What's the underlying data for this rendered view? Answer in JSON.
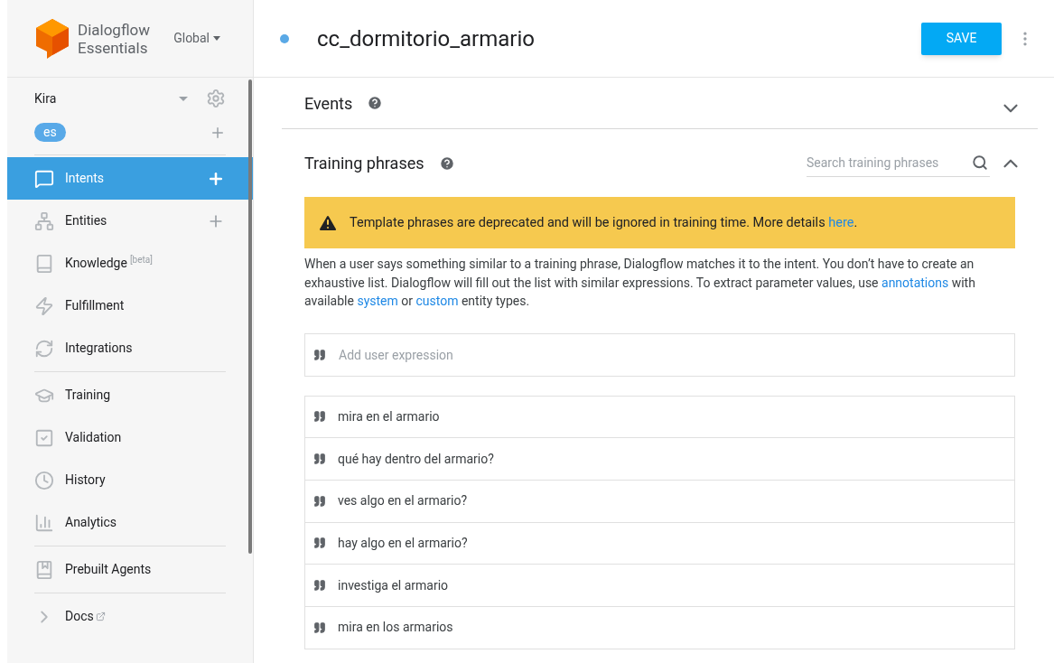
{
  "brand": {
    "line1": "Dialogflow",
    "line2": "Essentials",
    "region": "Global"
  },
  "agent": {
    "name": "Kira",
    "language": "es"
  },
  "nav_groups": [
    [
      {
        "label": "Intents",
        "selected": true,
        "addable": true
      },
      {
        "label": "Entities",
        "selected": false,
        "addable": true
      },
      {
        "label": "Knowledge",
        "badge": "[beta]",
        "selected": false,
        "addable": false
      },
      {
        "label": "Fulfillment",
        "selected": false,
        "addable": false
      },
      {
        "label": "Integrations",
        "selected": false,
        "addable": false
      }
    ],
    [
      {
        "label": "Training",
        "selected": false,
        "addable": false
      },
      {
        "label": "Validation",
        "selected": false,
        "addable": false
      },
      {
        "label": "History",
        "selected": false,
        "addable": false
      },
      {
        "label": "Analytics",
        "selected": false,
        "addable": false
      }
    ],
    [
      {
        "label": "Prebuilt Agents",
        "selected": false,
        "addable": false
      }
    ],
    [
      {
        "label": "Docs",
        "selected": false,
        "addable": false,
        "external": true
      }
    ]
  ],
  "header": {
    "title": "cc_dormitorio_armario",
    "save": "SAVE"
  },
  "sections": [
    {
      "title": "Events",
      "expanded": false
    },
    {
      "title": "Training phrases",
      "expanded": true
    }
  ],
  "training": {
    "search_placeholder": "Search training phrases",
    "warning": {
      "text": "Template phrases are deprecated and will be ignored in training time. More details ",
      "link": "here",
      "after": "."
    },
    "description": [
      {
        "kind": "text",
        "text": "When a user says something similar to a training phrase, Dialogflow matches it to the intent. You don’t have to create an exhaustive list. Dialogflow will fill out the list with similar expressions. To extract parameter values, use "
      },
      {
        "kind": "link",
        "text": "annotations"
      },
      {
        "kind": "text",
        "text": " with available "
      },
      {
        "kind": "link",
        "text": "system"
      },
      {
        "kind": "text",
        "text": " or "
      },
      {
        "kind": "link",
        "text": "custom"
      },
      {
        "kind": "text",
        "text": " entity types."
      }
    ],
    "input_placeholder": "Add user expression",
    "phrases": [
      "mira en el armario",
      "qué hay dentro del armario?",
      "ves algo en el armario?",
      "hay algo en el armario?",
      "investiga el armario",
      "mira en los armarios"
    ]
  }
}
